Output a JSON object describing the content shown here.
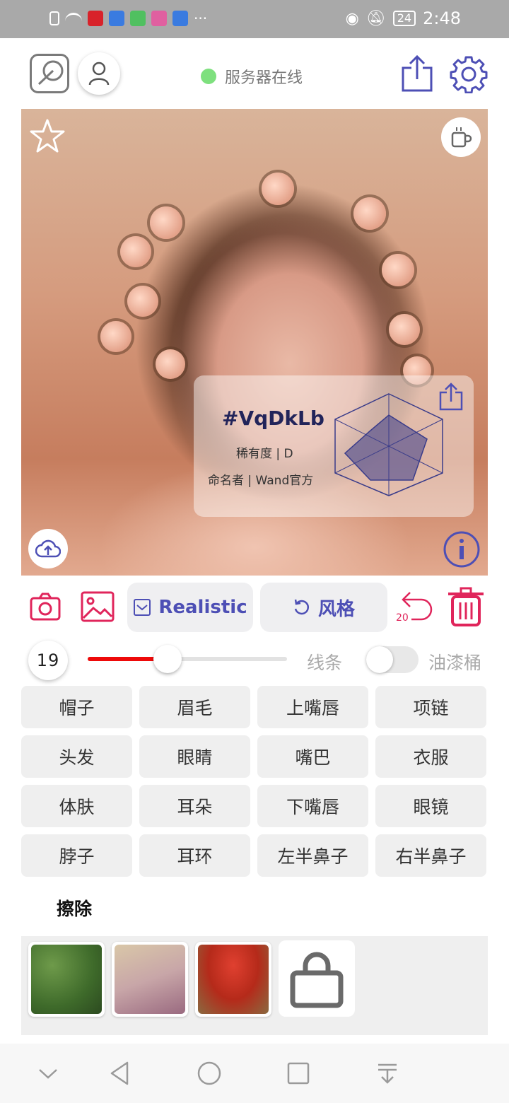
{
  "status_bar": {
    "time": "2:48",
    "battery": "24"
  },
  "header": {
    "server_status": "服务器在线",
    "server_dot_color": "#7ee07e"
  },
  "artwork": {
    "id": "#VqDkLb",
    "rarity": "稀有度 | D",
    "namer": "命名者 | Wand官方"
  },
  "toolbar": {
    "mode_label": "Realistic",
    "style_label": "风格",
    "undo_count": "20",
    "accent": "#4d4fb5",
    "danger": "#e0255b"
  },
  "brush": {
    "size": "19",
    "size_fraction": 0.4,
    "line_label": "线条",
    "bucket_label": "油漆桶",
    "bucket_on": false
  },
  "parts": [
    "帽子",
    "眉毛",
    "上嘴唇",
    "项链",
    "头发",
    "眼睛",
    "嘴巴",
    "衣服",
    "体肤",
    "耳朵",
    "下嘴唇",
    "眼镜",
    "脖子",
    "耳环",
    "左半鼻子",
    "右半鼻子"
  ],
  "erase_label": "擦除",
  "icons": {
    "edit": "edit-icon",
    "user": "user-icon",
    "share": "share-icon",
    "settings": "gear-icon",
    "favorite": "star-icon",
    "coffee": "coffee-icon",
    "upload": "cloud-upload-icon",
    "info": "info-icon",
    "camera": "camera-icon",
    "gallery": "gallery-icon",
    "undo": "undo-icon",
    "delete": "trash-icon",
    "shop": "shopping-bag-icon"
  }
}
